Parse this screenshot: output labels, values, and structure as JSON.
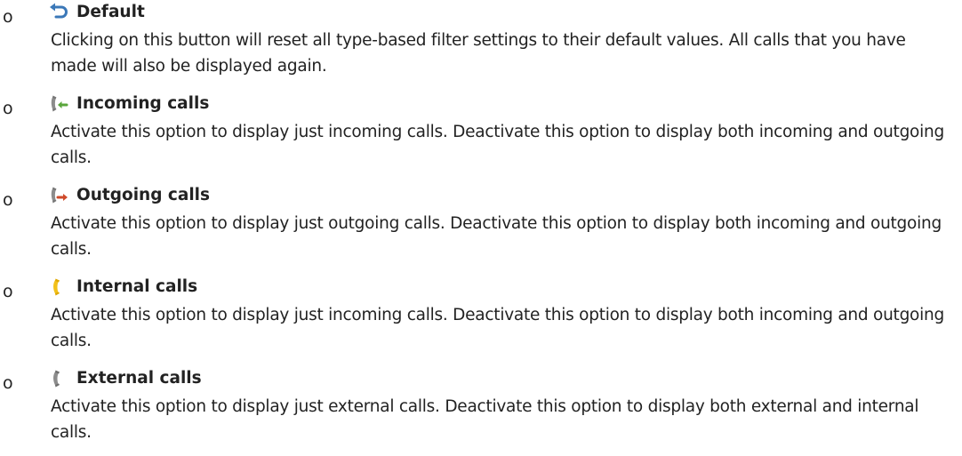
{
  "items": [
    {
      "bullet": "o",
      "icon": "reset-arrow-icon",
      "title": "Default",
      "description": "Clicking on this button will reset all type-based filter settings to their default values. All calls that you have made will also be displayed again."
    },
    {
      "bullet": "o",
      "icon": "incoming-call-icon",
      "title": "Incoming calls",
      "description": "Activate this option to display just incoming calls. Deactivate this option to display both incoming and outgoing calls."
    },
    {
      "bullet": "o",
      "icon": "outgoing-call-icon",
      "title": "Outgoing calls",
      "description": "Activate this option to display just outgoing calls. Deactivate this option to display both incoming and outgoing calls."
    },
    {
      "bullet": "o",
      "icon": "internal-call-icon",
      "title": "Internal calls",
      "description": "Activate this option to display just incoming calls. Deactivate this option to display both incoming and outgoing calls."
    },
    {
      "bullet": "o",
      "icon": "external-call-icon",
      "title": "External calls",
      "description": "Activate this option to display just external calls. Deactivate this option to display both external and internal calls."
    }
  ],
  "colors": {
    "reset_arrow": "#3b78b8",
    "incoming_arrow": "#5aa63c",
    "outgoing_arrow": "#cf4a2a",
    "internal_handset": "#f2c11a",
    "handset_gray": "#8c8c8c"
  }
}
